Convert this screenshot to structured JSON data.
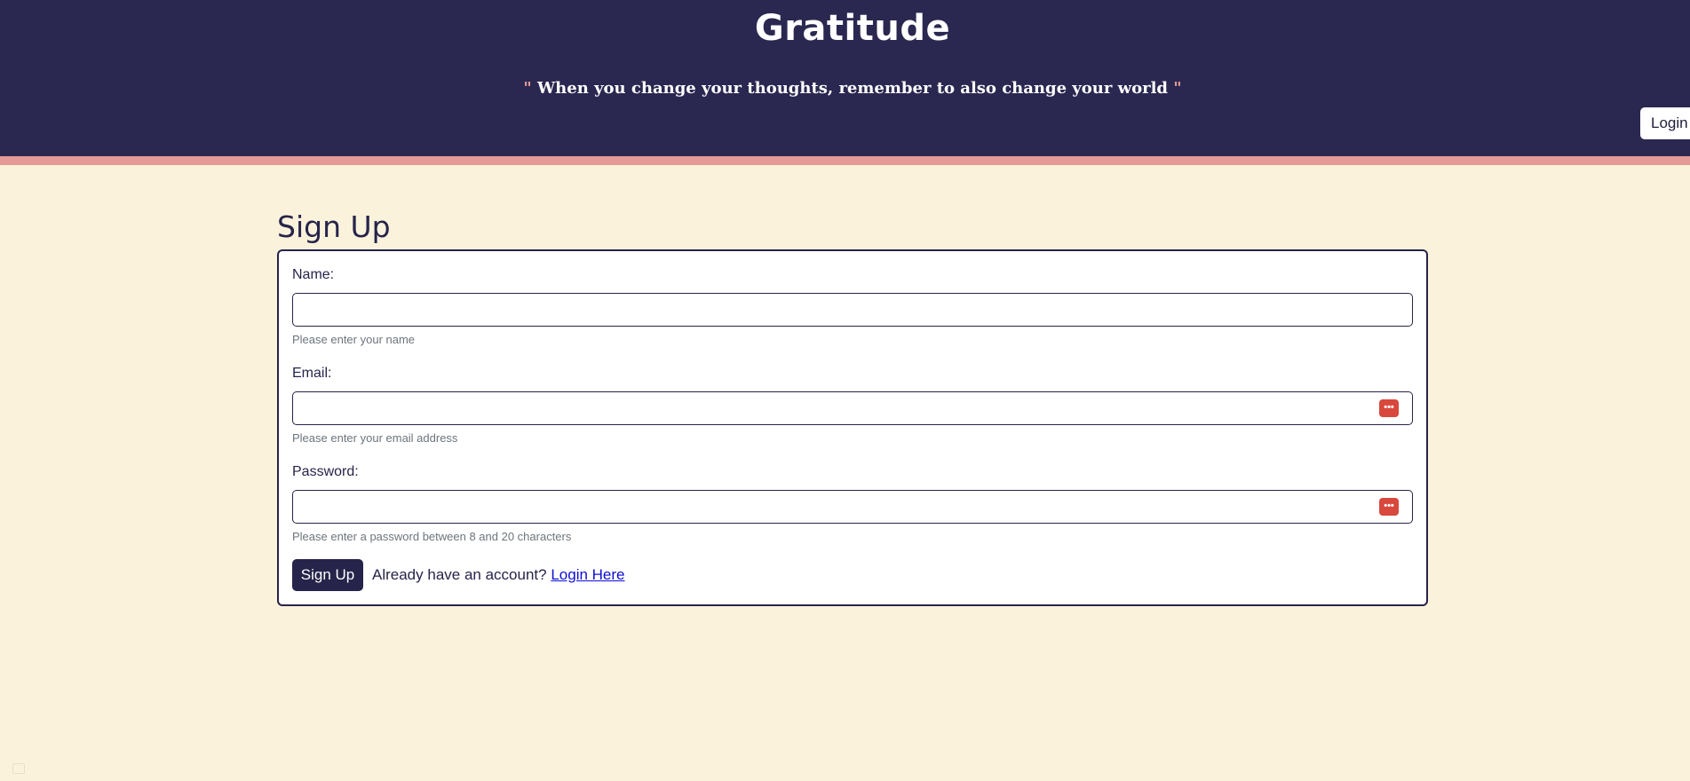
{
  "header": {
    "title": "Gratitude",
    "quote_open": "\"",
    "quote_text": " When you change your thoughts, remember to also change your world ",
    "quote_close": "\"",
    "login_button": "Login"
  },
  "colors": {
    "header_bg": "#2a2850",
    "accent_stripe": "#e49a96",
    "page_bg": "#fbf2dc",
    "primary": "#26244a",
    "link": "#0d0dd6",
    "password_manager_icon": "#d8483c"
  },
  "page": {
    "title": "Sign Up"
  },
  "form": {
    "name": {
      "label": "Name:",
      "value": "",
      "help": "Please enter your name"
    },
    "email": {
      "label": "Email:",
      "value": "",
      "help": "Please enter your email address",
      "icon": "password-manager-icon"
    },
    "password": {
      "label": "Password:",
      "value": "",
      "help": "Please enter a password between 8 and 20 characters",
      "icon": "password-manager-icon"
    },
    "submit_label": "Sign Up",
    "account_prompt": "Already have an account?",
    "login_link": "Login Here"
  }
}
